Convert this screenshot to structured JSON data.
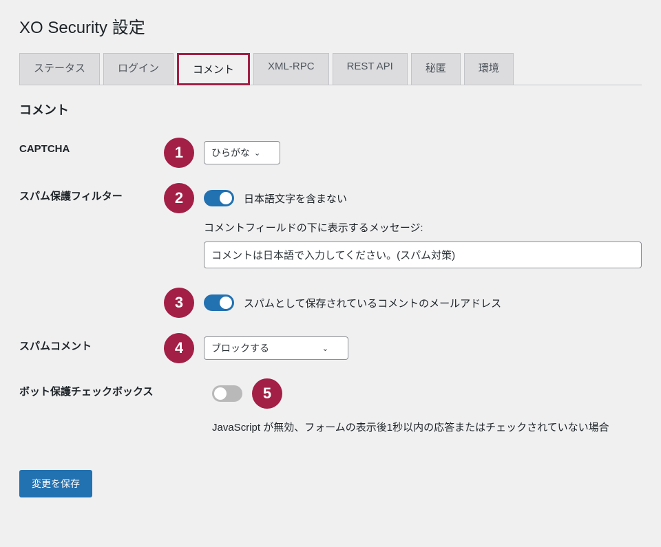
{
  "page_title": "XO Security 設定",
  "tabs": [
    {
      "label": "ステータス",
      "active": false
    },
    {
      "label": "ログイン",
      "active": false
    },
    {
      "label": "コメント",
      "active": true
    },
    {
      "label": "XML-RPC",
      "active": false
    },
    {
      "label": "REST API",
      "active": false
    },
    {
      "label": "秘匿",
      "active": false
    },
    {
      "label": "環境",
      "active": false
    }
  ],
  "section_title": "コメント",
  "badges": {
    "b1": "1",
    "b2": "2",
    "b3": "3",
    "b4": "4",
    "b5": "5"
  },
  "rows": {
    "captcha": {
      "label": "CAPTCHA",
      "value": "ひらがな"
    },
    "spam_filter": {
      "label": "スパム保護フィルター",
      "toggle1_label": "日本語文字を含まない",
      "message_label": "コメントフィールドの下に表示するメッセージ:",
      "message_value": "コメントは日本語で入力してください。(スパム対策)",
      "toggle2_label": "スパムとして保存されているコメントのメールアドレス"
    },
    "spam_comment": {
      "label": "スパムコメント",
      "value": "ブロックする"
    },
    "bot_protect": {
      "label": "ボット保護チェックボックス",
      "help": "JavaScript が無効、フォームの表示後1秒以内の応答またはチェックされていない場合"
    }
  },
  "submit_label": "変更を保存"
}
